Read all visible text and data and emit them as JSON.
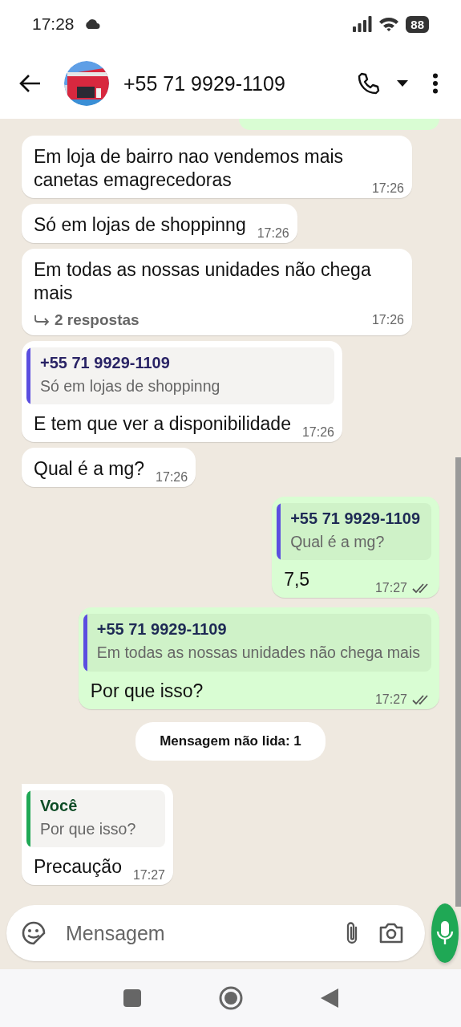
{
  "status_bar": {
    "time": "17:28",
    "battery": "88"
  },
  "header": {
    "title": "+55 71 9929-1109"
  },
  "messages": [
    {
      "kind": "cut",
      "outgoing": true
    },
    {
      "kind": "message",
      "outgoing": false,
      "text": "Em loja de bairro nao vendemos mais canetas emagrecedoras",
      "time": "17:26"
    },
    {
      "kind": "message",
      "outgoing": false,
      "text": "Só em lojas de shoppinng",
      "time": "17:26"
    },
    {
      "kind": "message",
      "outgoing": false,
      "text": "Em todas as nossas unidades não chega mais",
      "time": "17:26",
      "replies": "2 respostas"
    },
    {
      "kind": "message",
      "outgoing": false,
      "quote": {
        "author": "+55 71 9929-1109",
        "text": "Só em lojas de shoppinng",
        "color": "#5b4ee0"
      },
      "text": "E tem que ver a disponibilidade",
      "time": "17:26"
    },
    {
      "kind": "message",
      "outgoing": false,
      "text": "Qual é a mg?",
      "time": "17:26"
    },
    {
      "kind": "message",
      "outgoing": true,
      "quote": {
        "author": "+55 71 9929-1109",
        "text": "Qual é a mg?",
        "color": "#5b4ee0"
      },
      "text": "7,5",
      "time": "17:27",
      "read": true
    },
    {
      "kind": "message",
      "outgoing": true,
      "quote": {
        "author": "+55 71 9929-1109",
        "text": "Em todas as nossas unidades não chega mais",
        "color": "#5b4ee0"
      },
      "text": "Por que isso?",
      "time": "17:27",
      "read": true
    },
    {
      "kind": "notice",
      "text": "Mensagem não lida: 1"
    },
    {
      "kind": "message",
      "outgoing": false,
      "tail": true,
      "quote": {
        "author": "Você",
        "text": "Por que isso?",
        "color": "#1fa855"
      },
      "text": "Precaução",
      "time": "17:27"
    }
  ],
  "composer": {
    "placeholder": "Mensagem"
  }
}
